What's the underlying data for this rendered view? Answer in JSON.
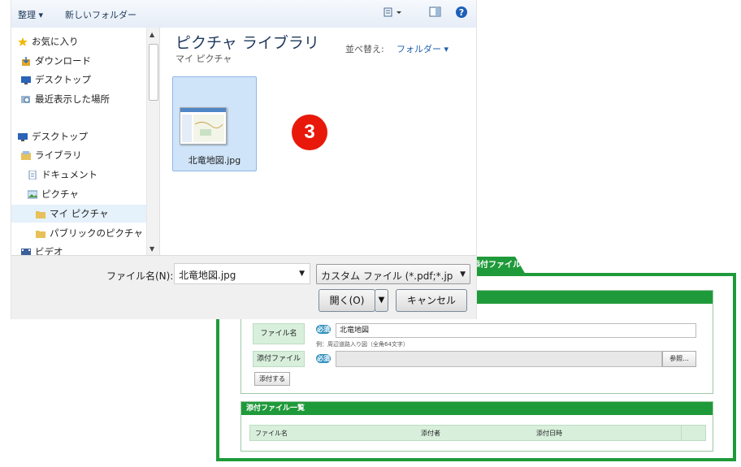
{
  "dialog": {
    "toolbar": {
      "organize": "整理 ▾",
      "new_folder": "新しいフォルダー"
    },
    "nav": {
      "items": [
        {
          "label": "お気に入り",
          "icon": "star-icon"
        },
        {
          "label": "ダウンロード",
          "icon": "download-icon"
        },
        {
          "label": "デスクトップ",
          "icon": "desktop-icon"
        },
        {
          "label": "最近表示した場所",
          "icon": "recent-places-icon"
        },
        {
          "label": "デスクトップ",
          "icon": "desktop-icon"
        },
        {
          "label": "ライブラリ",
          "icon": "library-icon"
        },
        {
          "label": "ドキュメント",
          "icon": "documents-icon"
        },
        {
          "label": "ピクチャ",
          "icon": "pictures-icon"
        },
        {
          "label": "マイ ピクチャ",
          "icon": "folder-icon"
        },
        {
          "label": "パブリックのピクチャ",
          "icon": "folder-icon"
        },
        {
          "label": "ビデオ",
          "icon": "video-icon"
        }
      ]
    },
    "content": {
      "library_title": "ピクチャ ライブラリ",
      "library_subtitle": "マイ ピクチャ",
      "arrange_label": "並べ替え:",
      "arrange_value": "フォルダー ▾",
      "file_name": "北竜地図.jpg"
    },
    "bottom": {
      "filename_label": "ファイル名(N):",
      "filename_value": "北竜地図.jpg",
      "filter_value": "カスタム ファイル (*.pdf;*.jp",
      "open_button": "開く(O)",
      "cancel_button": "キャンセル"
    }
  },
  "step_badge": "3",
  "webform": {
    "tab_label": "添付ファイル",
    "panel1": {
      "file_name_label": "ファイル名",
      "required": "必須",
      "file_name_value": "北竜地図",
      "hint": "例：周辺道路入り図（全角64文字）",
      "attach_label": "添付ファイル",
      "browse_button": "参照...",
      "attach_button": "添付する"
    },
    "panel2": {
      "title": "添付ファイル一覧",
      "columns": [
        "ファイル名",
        "添付者",
        "添付日時"
      ]
    }
  },
  "colors": {
    "accent_green": "#1f9a3a",
    "badge_red": "#e8190b",
    "link_blue": "#1e5fae"
  }
}
